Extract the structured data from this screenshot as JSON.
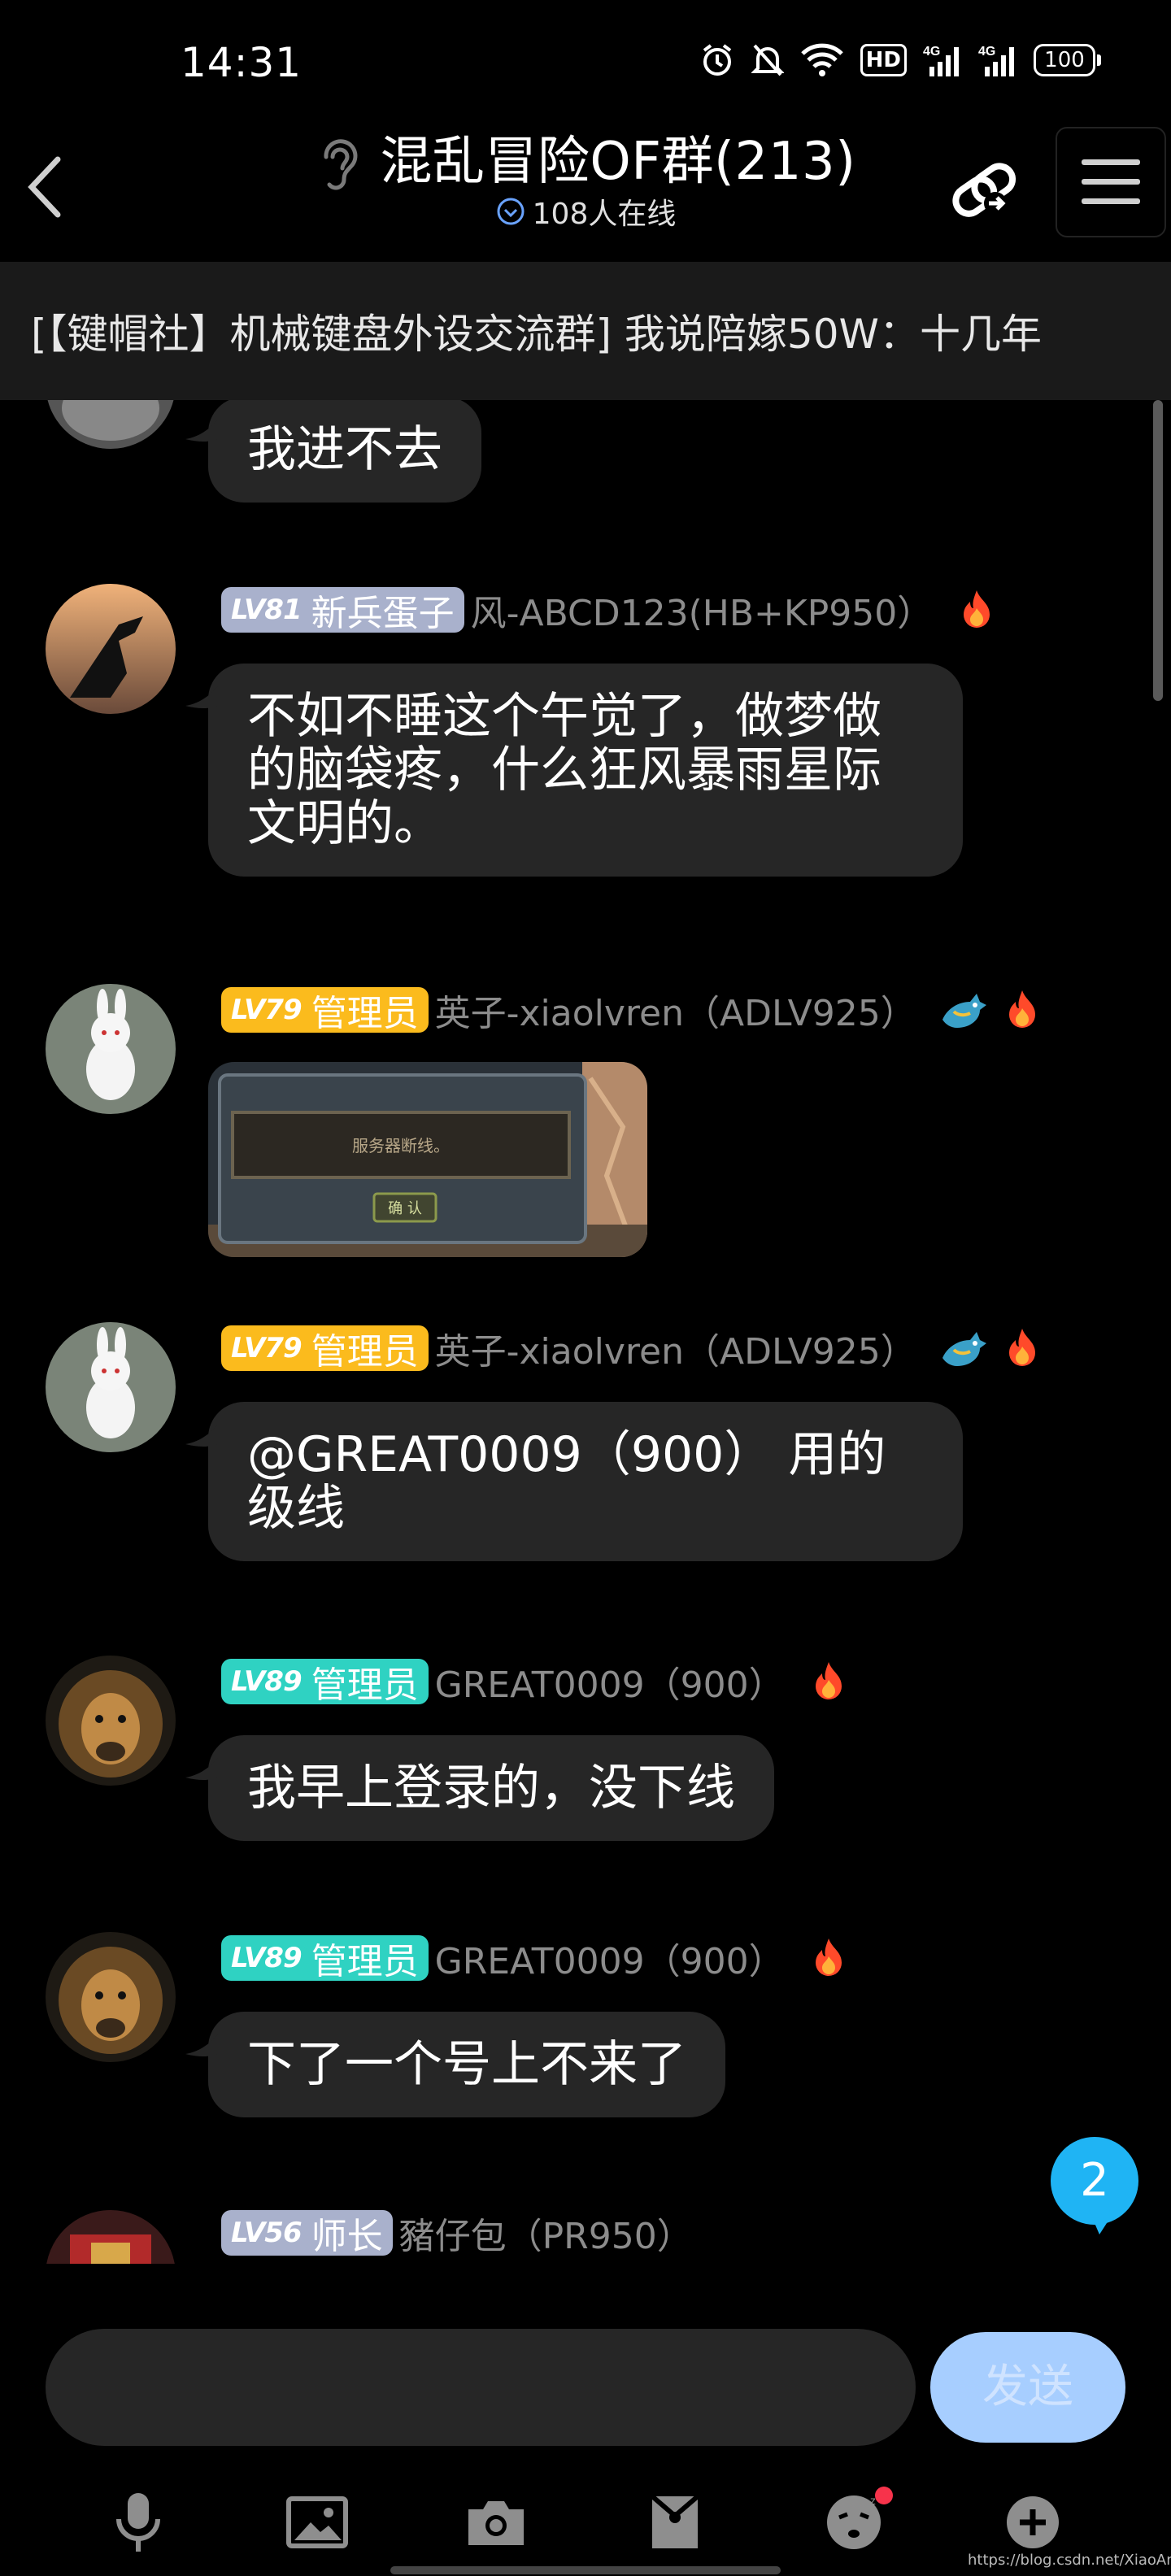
{
  "status_bar": {
    "time": "14:31",
    "hd_label": "HD",
    "net1": "4G",
    "net2": "4G",
    "battery": "100"
  },
  "header": {
    "title": "混乱冒险OF群(213)",
    "online": "108人在线",
    "icons": [
      "back-icon",
      "ear-icon",
      "share-link-icon",
      "menu-icon"
    ]
  },
  "notice": {
    "text": "[【键帽社】机械键盘外设交流群] 我说陪嫁50W：十几年"
  },
  "messages": [
    {
      "text": "我进不去"
    },
    {
      "level": "LV81",
      "role": "新兵蛋子",
      "badge_color": "#a9b1cc",
      "name": "风-ABCD123(HB+KP950）",
      "text": "不如不睡这个午觉了，做梦做的脑袋疼，什么狂风暴雨星际文明的。"
    },
    {
      "level": "LV79",
      "role": "管理员",
      "badge_color": "#fbbb1d",
      "name": "英子-xiaolvren（ADLV925）",
      "image_text": "服务器断线。",
      "image_button": "确 认"
    },
    {
      "level": "LV79",
      "role": "管理员",
      "badge_color": "#fbbb1d",
      "name": "英子-xiaolvren（ADLV925）",
      "text": "@GREAT0009（900） 用的级线"
    },
    {
      "level": "LV89",
      "role": "管理员",
      "badge_color": "#2fd2c2",
      "name": "GREAT0009（900）",
      "text": "我早上登录的，没下线"
    },
    {
      "level": "LV89",
      "role": "管理员",
      "badge_color": "#2fd2c2",
      "name": "GREAT0009（900）",
      "text": "下了一个号上不来了"
    },
    {
      "level": "LV56",
      "role": "师长",
      "badge_color": "#a9b1cc",
      "name": "豬仔包（PR950）"
    }
  ],
  "unread_count": "2",
  "input": {
    "placeholder": "",
    "send_label": "发送"
  },
  "toolbar": [
    "microphone-icon",
    "image-icon",
    "camera-icon",
    "red-packet-icon",
    "emoji-icon",
    "plus-icon"
  ],
  "watermark": "https://blog.csdn.net/XiaoAnGeGe"
}
